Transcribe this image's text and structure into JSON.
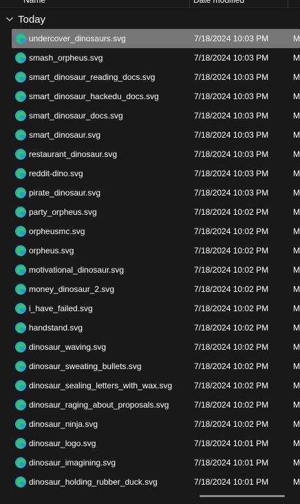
{
  "header": {
    "name_label": "Name",
    "date_label": "Date modified"
  },
  "group": {
    "label": "Today"
  },
  "colors": {
    "background": "#191919",
    "selected_row": "#777777",
    "icon_primary": "#1f9fd8",
    "icon_secondary": "#36c46b"
  },
  "icon": "edge-svg-file-icon",
  "files": [
    {
      "name": "undercover_dinosaurs.svg",
      "date": "7/18/2024 10:03 PM",
      "type": "M",
      "selected": true
    },
    {
      "name": "smash_orpheus.svg",
      "date": "7/18/2024 10:03 PM",
      "type": "M"
    },
    {
      "name": "smart_dinosaur_reading_docs.svg",
      "date": "7/18/2024 10:03 PM",
      "type": "M"
    },
    {
      "name": "smart_dinosaur_hackedu_docs.svg",
      "date": "7/18/2024 10:03 PM",
      "type": "M"
    },
    {
      "name": "smart_dinosaur_docs.svg",
      "date": "7/18/2024 10:03 PM",
      "type": "M"
    },
    {
      "name": "smart_dinosaur.svg",
      "date": "7/18/2024 10:03 PM",
      "type": "M"
    },
    {
      "name": "restaurant_dinosaur.svg",
      "date": "7/18/2024 10:03 PM",
      "type": "M"
    },
    {
      "name": "reddit-dino.svg",
      "date": "7/18/2024 10:03 PM",
      "type": "M"
    },
    {
      "name": "pirate_dinosaur.svg",
      "date": "7/18/2024 10:03 PM",
      "type": "M"
    },
    {
      "name": "party_orpheus.svg",
      "date": "7/18/2024 10:02 PM",
      "type": "M"
    },
    {
      "name": "orpheusmc.svg",
      "date": "7/18/2024 10:02 PM",
      "type": "M"
    },
    {
      "name": "orpheus.svg",
      "date": "7/18/2024 10:02 PM",
      "type": "M"
    },
    {
      "name": "motivational_dinosaur.svg",
      "date": "7/18/2024 10:02 PM",
      "type": "M"
    },
    {
      "name": "money_dinosaur_2.svg",
      "date": "7/18/2024 10:02 PM",
      "type": "M"
    },
    {
      "name": "i_have_failed.svg",
      "date": "7/18/2024 10:02 PM",
      "type": "M"
    },
    {
      "name": "handstand.svg",
      "date": "7/18/2024 10:02 PM",
      "type": "M"
    },
    {
      "name": "dinosaur_waving.svg",
      "date": "7/18/2024 10:02 PM",
      "type": "M"
    },
    {
      "name": "dinosaur_sweating_bullets.svg",
      "date": "7/18/2024 10:02 PM",
      "type": "M"
    },
    {
      "name": "dinosaur_sealing_letters_with_wax.svg",
      "date": "7/18/2024 10:02 PM",
      "type": "M"
    },
    {
      "name": "dinosaur_raging_about_proposals.svg",
      "date": "7/18/2024 10:02 PM",
      "type": "M"
    },
    {
      "name": "dinosaur_ninja.svg",
      "date": "7/18/2024 10:02 PM",
      "type": "M"
    },
    {
      "name": "dinosaur_logo.svg",
      "date": "7/18/2024 10:01 PM",
      "type": "M"
    },
    {
      "name": "dinosaur_imagining.svg",
      "date": "7/18/2024 10:01 PM",
      "type": "M"
    },
    {
      "name": "dinosaur_holding_rubber_duck.svg",
      "date": "7/18/2024 10:01 PM",
      "type": "M"
    }
  ]
}
